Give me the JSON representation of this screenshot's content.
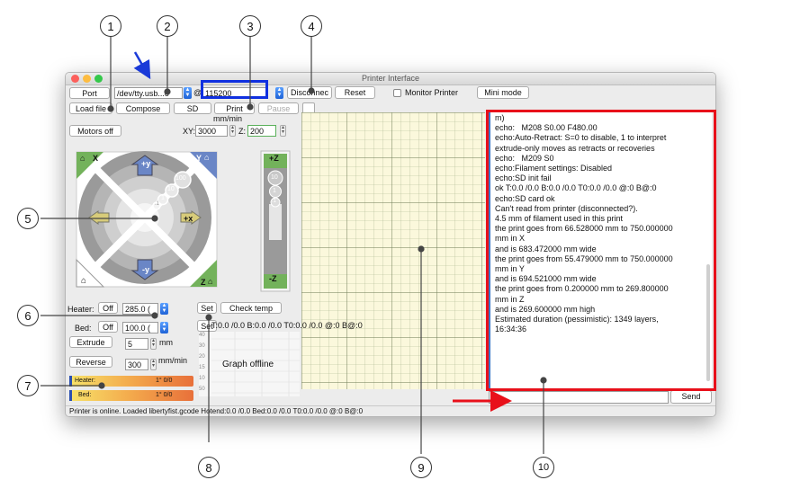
{
  "window": {
    "title": "Printer Interface"
  },
  "toolbar": {
    "port_label": "Port",
    "port_value": "/dev/tty.usb...o",
    "at": "@",
    "baud_value": "115200",
    "disconnect_label": "Disconnec",
    "reset_label": "Reset",
    "monitor_label": "Monitor Printer",
    "mini_mode_label": "Mini mode",
    "load_file_label": "Load file",
    "compose_label": "Compose",
    "sd_label": "SD",
    "print_label": "Print",
    "pause_label": "Pause"
  },
  "motors": {
    "motors_off_label": "Motors off",
    "speed_unit": "mm/min",
    "xy_label": "XY:",
    "xy_value": "3000",
    "z_label": "Z:",
    "z_value": "200"
  },
  "jog": {
    "home_x": "X",
    "home_y": "Y",
    "home_z": "Z",
    "plus_y": "+y",
    "minus_y": "-y",
    "plus_x": "+x",
    "plus_z": "+Z",
    "minus_z": "-Z",
    "step_100": "100",
    "step_10": "10",
    "step_1": "1",
    "step_01": ".1",
    "zstep_10": "10",
    "zstep_1": "1",
    "zstep_01": ".1"
  },
  "temps": {
    "heater_label": "Heater:",
    "heater_off": "Off",
    "heater_value": "285.0 (",
    "bed_label": "Bed:",
    "bed_off": "Off",
    "bed_value": "100.0 (",
    "set_label": "Set",
    "check_temp_label": "Check temp",
    "set2_label": "Set",
    "readout": "T:0.0 /0.0 B:0.0 /0.0 T0:0.0 /0.0 @:0 B@:0"
  },
  "extrude": {
    "extrude_label": "Extrude",
    "extrude_value": "5",
    "mm_unit": "mm",
    "reverse_label": "Reverse",
    "speed_value": "300",
    "speed_unit": "mm/min"
  },
  "graph": {
    "ticks": [
      "40",
      "30",
      "20",
      "15",
      "10",
      "50"
    ],
    "offline_label": "Graph offline"
  },
  "gauges": {
    "heater_label": "Heater:",
    "heater_value": "1° 0/0",
    "bed_label": "Bed:",
    "bed_value": "1° 0/0"
  },
  "log": {
    "lines": [
      "m)",
      "echo:   M208 S0.00 F480.00",
      "echo:Auto-Retract: S=0 to disable, 1 to interpret",
      "extrude-only moves as retracts or recoveries",
      "echo:   M209 S0",
      "echo:Filament settings: Disabled",
      "echo:SD init fail",
      "ok T:0.0 /0.0 B:0.0 /0.0 T0:0.0 /0.0 @:0 B@:0",
      "echo:SD card ok",
      "Can't read from printer (disconnected?).",
      "4.5 mm of filament used in this print",
      "",
      "the print goes from 66.528000 mm to 750.000000",
      "mm in X",
      "and is 683.472000 mm wide",
      "",
      "the print goes from 55.479000 mm to 750.000000",
      "mm in Y",
      "and is 694.521000 mm wide",
      "",
      "the print goes from 0.200000 mm to 269.800000",
      "mm in Z",
      "and is 269.600000 mm high",
      "",
      "Estimated duration (pessimistic): 1349 layers,",
      "16:34:36"
    ],
    "send_label": "Send"
  },
  "status": {
    "text": "Printer is online. Loaded libertyfist.gcode  Hotend:0.0 /0.0 Bed:0.0 /0.0 T0:0.0 /0.0 @:0 B@:0"
  },
  "callouts": [
    "1",
    "2",
    "3",
    "4",
    "5",
    "6",
    "7",
    "8",
    "9",
    "10"
  ],
  "colors": {
    "highlight_blue": "#1030e0",
    "highlight_red": "#e8101a",
    "leader_arrow": "#e8101a",
    "blue_arrow": "#1a3ad8",
    "grid_bg": "#fbf8dc",
    "jog_green": "#73b25b",
    "jog_blue": "#6a86c6",
    "jog_yellow": "#d8cc7a"
  }
}
